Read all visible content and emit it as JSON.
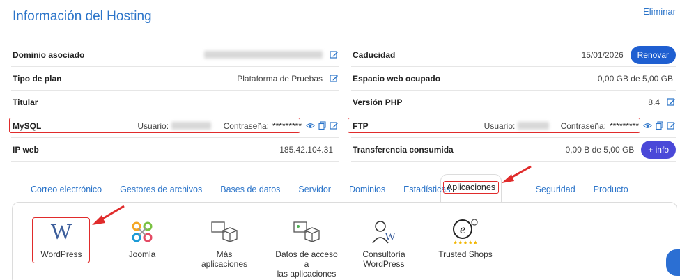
{
  "header": {
    "title": "Información del Hosting",
    "delete_label": "Eliminar"
  },
  "left_rows": {
    "domain": {
      "label": "Dominio asociado"
    },
    "plan": {
      "label": "Tipo de plan",
      "value": "Plataforma de Pruebas"
    },
    "owner": {
      "label": "Titular"
    },
    "mysql": {
      "label": "MySQL",
      "user_label": "Usuario:",
      "password_label": "Contraseña:",
      "password_value": "*********"
    },
    "ip": {
      "label": "IP web",
      "value": "185.42.104.31"
    }
  },
  "right_rows": {
    "expiry": {
      "label": "Caducidad",
      "value": "15/01/2026",
      "button": "Renovar"
    },
    "space": {
      "label": "Espacio web ocupado",
      "value": "0,00 GB de 5,00 GB"
    },
    "php": {
      "label": "Versión PHP",
      "value": "8.4"
    },
    "ftp": {
      "label": "FTP",
      "user_label": "Usuario:",
      "password_label": "Contraseña:",
      "password_value": "*********"
    },
    "transfer": {
      "label": "Transferencia consumida",
      "value": "0,00 B de 5,00 GB",
      "button": "+ info"
    }
  },
  "tabs": [
    "Correo electrónico",
    "Gestores de archivos",
    "Bases de datos",
    "Servidor",
    "Dominios",
    "Estadísticas",
    "Aplicaciones",
    "Seguridad",
    "Producto"
  ],
  "apps": {
    "wordpress": "WordPress",
    "joomla": "Joomla",
    "more": "Más aplicaciones",
    "access_line1": "Datos de acceso a",
    "access_line2": "las aplicaciones",
    "consult_line1": "Consultoría",
    "consult_line2": "WordPress",
    "trusted": "Trusted Shops"
  },
  "colors": {
    "accent": "#2b74c9",
    "highlight": "#e02b2b",
    "button": "#1f5fd1"
  }
}
